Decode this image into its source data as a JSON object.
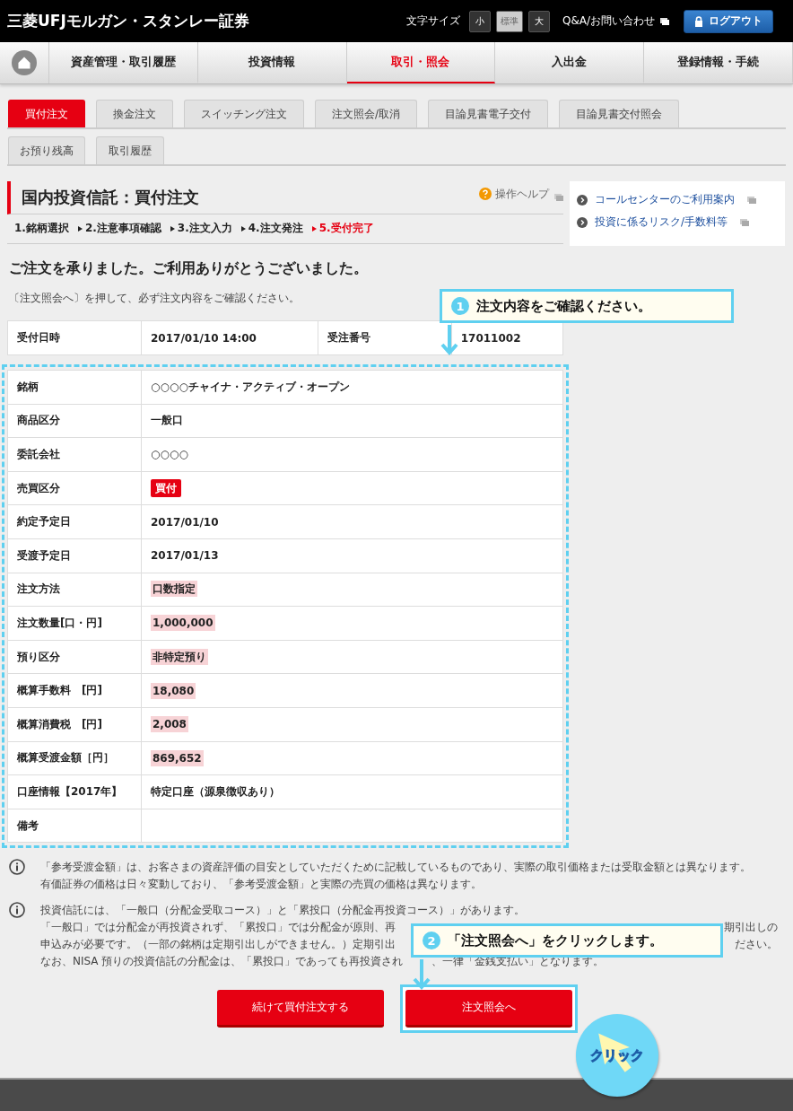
{
  "header": {
    "logo": "三菱UFJモルガン・スタンレー証券",
    "font_size_label": "文字サイズ",
    "font_sizes": [
      {
        "label": "小",
        "selected": false
      },
      {
        "label": "標準",
        "selected": true
      },
      {
        "label": "大",
        "selected": false
      }
    ],
    "help_link": "Q&A/お問い合わせ",
    "logout": "ログアウト"
  },
  "nav": [
    {
      "label": "資産管理・取引履歴",
      "selected": false
    },
    {
      "label": "投資情報",
      "selected": false
    },
    {
      "label": "取引・照会",
      "selected": true
    },
    {
      "label": "入出金",
      "selected": false
    },
    {
      "label": "登録情報・手続",
      "selected": false
    }
  ],
  "tabs": [
    [
      {
        "label": "買付注文",
        "selected": true
      },
      {
        "label": "換金注文",
        "selected": false
      },
      {
        "label": "スイッチング注文",
        "selected": false
      },
      {
        "label": "注文照会/取消",
        "selected": false
      },
      {
        "label": "目論見書電子交付",
        "selected": false
      },
      {
        "label": "目論見書交付照会",
        "selected": false
      }
    ],
    [
      {
        "label": "お預り残高",
        "selected": false
      },
      {
        "label": "取引履歴",
        "selected": false
      }
    ]
  ],
  "title": "国内投資信託：買付注文",
  "help": "操作ヘルプ",
  "steps": [
    {
      "label": "1.銘柄選択",
      "selected": false
    },
    {
      "label": "2.注意事項確認",
      "selected": false
    },
    {
      "label": "3.注文入力",
      "selected": false
    },
    {
      "label": "4.注文発注",
      "selected": false
    },
    {
      "label": "5.受付完了",
      "selected": true
    }
  ],
  "side_links": [
    "コールセンターのご利用案内",
    "投資に係るリスク/手数料等"
  ],
  "thanks": "ご注文を承りました。ご利用ありがとうございました。",
  "instruction": "〔注文照会へ〕を押して、必ず注文内容をご確認ください。",
  "receipt": [
    {
      "label": "受付日時",
      "value": "2017/01/10 14:00"
    },
    {
      "label": "受注番号",
      "value": "17011002"
    }
  ],
  "details": [
    {
      "label": "銘柄",
      "value": "○○○○チャイナ・アクティブ・オープン",
      "kind": "text",
      "highlighted": false
    },
    {
      "label": "商品区分",
      "value": "一般口",
      "kind": "text",
      "highlighted": false
    },
    {
      "label": "委託会社",
      "value": "○○○○",
      "kind": "text",
      "highlighted": false
    },
    {
      "label": "売買区分",
      "value": "買付",
      "kind": "badge",
      "highlighted": false
    },
    {
      "label": "約定予定日",
      "value": "2017/01/10",
      "kind": "text",
      "highlighted": false
    },
    {
      "label": "受渡予定日",
      "value": "2017/01/13",
      "kind": "text",
      "highlighted": false
    },
    {
      "label": "注文方法",
      "value": "口数指定",
      "kind": "text",
      "highlighted": true
    },
    {
      "label": "注文数量[口・円]",
      "value": "1,000,000",
      "kind": "text",
      "highlighted": true
    },
    {
      "label": "預り区分",
      "value": "非特定預り",
      "kind": "text",
      "highlighted": true
    },
    {
      "label": "概算手数料　[円]",
      "value": "18,080",
      "kind": "text",
      "highlighted": true
    },
    {
      "label": "概算消費税　[円]",
      "value": "2,008",
      "kind": "text",
      "highlighted": true
    },
    {
      "label": "概算受渡金額［円］",
      "value": "869,652",
      "kind": "text",
      "highlighted": true
    },
    {
      "label": "口座情報【2017年】",
      "value": "特定口座（源泉徴収あり）",
      "kind": "text",
      "highlighted": false
    },
    {
      "label": "備考",
      "kind": "text",
      "highlighted": false
    }
  ],
  "notes": [
    {
      "lines": [
        {
          "kind": "whole",
          "left": "「参考受渡金額」は、お客さまの資産評価の目安としていただくために記載しているものであり、実際の取引価格または受取金額とは異なります。"
        },
        {
          "kind": "whole",
          "left": "有価証券の価格は日々変動しており、「参考受渡金額」と実際の売買の価格は異なります。"
        }
      ]
    },
    {
      "lines": [
        {
          "kind": "whole",
          "left": "投資信託には、「一般口（分配金受取コース）」と「累投口（分配金再投資コース）」があります。"
        },
        {
          "kind": "split",
          "left": "「一般口」では分配金が再投資されず、「累投口」では分配金が原則、再",
          "right": "期引出しの"
        },
        {
          "kind": "split",
          "left": "申込みが必要です。（一部の銘柄は定期引出しができません。）定期引出",
          "right": "ださい。"
        },
        {
          "kind": "joined",
          "left": "なお、NISA 預りの投資信託の分配金は、「累投口」であっても再投資され",
          "right": "、一律「金銭支払い」となります。"
        }
      ]
    }
  ],
  "buttons": [
    {
      "label": "続けて買付注文する",
      "highlighted": false
    },
    {
      "label": "注文照会へ",
      "highlighted": true
    }
  ],
  "callouts": [
    {
      "number": "1",
      "text": "注文内容をご確認ください。"
    },
    {
      "number": "2",
      "text": "「注文照会へ」をクリックします。"
    }
  ],
  "click_badge": "クリック"
}
